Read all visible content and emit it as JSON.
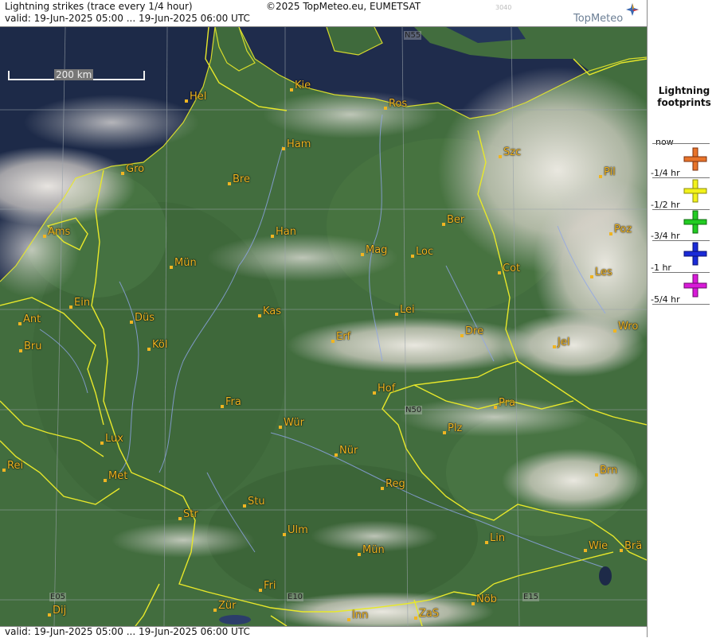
{
  "header": {
    "title": "Lightning strikes (trace every 1/4 hour)",
    "valid": "valid:  19-Jun-2025 05:00 ... 19-Jun-2025 06:00 UTC",
    "copyright": "©2025 TopMeteo.eu, EUMETSAT",
    "code": "3040",
    "logo": "TopMeteo"
  },
  "footer": {
    "valid": "valid:  19-Jun-2025 05:00 ... 19-Jun-2025 06:00 UTC"
  },
  "scale": {
    "label": "200 km"
  },
  "legend": {
    "title_line1": "Lightning",
    "title_line2": "footprints",
    "items": [
      {
        "label": "now",
        "color": ""
      },
      {
        "label": "-1/4 hr",
        "color": "#e8742a"
      },
      {
        "label": "-1/2 hr",
        "color": "#f2f21a"
      },
      {
        "label": "-3/4 hr",
        "color": "#22cc22"
      },
      {
        "label": "-1 hr",
        "color": "#1a2ad8"
      },
      {
        "label": "-5/4 hr",
        "color": "#d81ad8"
      }
    ]
  },
  "grid_labels": {
    "n55": "N55",
    "n50": "N50",
    "e05": "E05",
    "e10": "E10",
    "e15": "E15"
  },
  "cities": [
    {
      "name": "Hel"
    },
    {
      "name": "Kie"
    },
    {
      "name": "Ros"
    },
    {
      "name": "Ham"
    },
    {
      "name": "Szc"
    },
    {
      "name": "Gro"
    },
    {
      "name": "Bre"
    },
    {
      "name": "Pil"
    },
    {
      "name": "Ber"
    },
    {
      "name": "Ams"
    },
    {
      "name": "Han"
    },
    {
      "name": "Poz"
    },
    {
      "name": "Mag"
    },
    {
      "name": "Loc"
    },
    {
      "name": "Mün"
    },
    {
      "name": "Cot"
    },
    {
      "name": "Les"
    },
    {
      "name": "Ein"
    },
    {
      "name": "Kas"
    },
    {
      "name": "Lei"
    },
    {
      "name": "Ant"
    },
    {
      "name": "Düs"
    },
    {
      "name": "Wro"
    },
    {
      "name": "Bru"
    },
    {
      "name": "Köl"
    },
    {
      "name": "Erf"
    },
    {
      "name": "Dre"
    },
    {
      "name": "Jel"
    },
    {
      "name": "Hof"
    },
    {
      "name": "Fra"
    },
    {
      "name": "Pra"
    },
    {
      "name": "Wür"
    },
    {
      "name": "Plz"
    },
    {
      "name": "Lux"
    },
    {
      "name": "Nür"
    },
    {
      "name": "Rei"
    },
    {
      "name": "Met"
    },
    {
      "name": "Reg"
    },
    {
      "name": "Brn"
    },
    {
      "name": "Stu"
    },
    {
      "name": "Str"
    },
    {
      "name": "Ulm"
    },
    {
      "name": "Lin"
    },
    {
      "name": "Mün"
    },
    {
      "name": "Wie"
    },
    {
      "name": "Brä"
    },
    {
      "name": "Fri"
    },
    {
      "name": "Dij"
    },
    {
      "name": "Zür"
    },
    {
      "name": "Inn"
    },
    {
      "name": "ZaS"
    },
    {
      "name": "Nöb"
    }
  ]
}
